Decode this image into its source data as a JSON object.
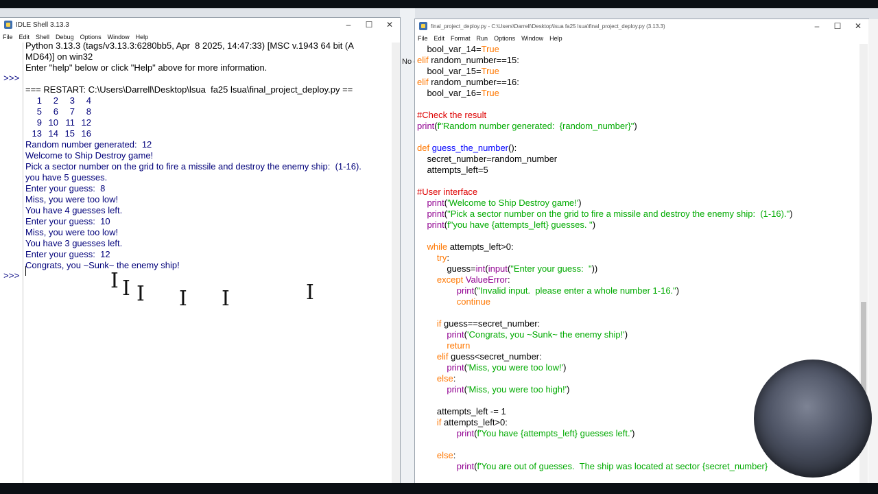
{
  "shell": {
    "title": "IDLE Shell 3.13.3",
    "menu": [
      "File",
      "Edit",
      "Shell",
      "Debug",
      "Options",
      "Window",
      "Help"
    ],
    "prompt": ">>>",
    "lines": [
      {
        "text": "Python 3.13.3 (tags/v3.13.3:6280bb5, Apr  8 2025, 14:47:33) [MSC v.1943 64 bit (A",
        "cls": "c-blk"
      },
      {
        "text": "MD64)] on win32",
        "cls": "c-blk"
      },
      {
        "text": "Enter \"help\" below or click \"Help\" above for more information.",
        "cls": "c-blk"
      },
      {
        "text": "",
        "cls": "c-blk"
      },
      {
        "text": "=== RESTART: C:\\Users\\Darrell\\Desktop\\lsua  fa25 lsua\\final_project_deploy.py ==",
        "cls": "c-blk"
      }
    ],
    "grid": [
      [
        "1",
        "2",
        "3",
        "4"
      ],
      [
        "5",
        "6",
        "7",
        "8"
      ],
      [
        "9",
        "10",
        "11",
        "12"
      ],
      [
        "13",
        "14",
        "15",
        "16"
      ]
    ],
    "output": [
      {
        "text": "Random number generated:  12",
        "cls": "c-out"
      },
      {
        "text": "Welcome to Ship Destroy game!",
        "cls": "c-out"
      },
      {
        "text": "Pick a sector number on the grid to fire a missile and destroy the enemy ship:  (1-16).",
        "cls": "c-out"
      },
      {
        "text": "you have 5 guesses.",
        "cls": "c-out"
      },
      {
        "text": "Enter your guess:  8",
        "cls": "c-out"
      },
      {
        "text": "Miss, you were too low!",
        "cls": "c-out"
      },
      {
        "text": "You have 4 guesses left.",
        "cls": "c-out"
      },
      {
        "text": "Enter your guess:  10",
        "cls": "c-out"
      },
      {
        "text": "Miss, you were too low!",
        "cls": "c-out"
      },
      {
        "text": "You have 3 guesses left.",
        "cls": "c-out"
      },
      {
        "text": "Enter your guess:  12",
        "cls": "c-out"
      },
      {
        "text": "Congrats, you ~Sunk~ the enemy ship!",
        "cls": "c-out"
      }
    ]
  },
  "editor": {
    "title": "final_project_deploy.py - C:\\Users\\Darrell\\Desktop\\lsua  fa25 lsua\\final_project_deploy.py (3.13.3)",
    "menu": [
      "File",
      "Edit",
      "Format",
      "Run",
      "Options",
      "Window",
      "Help"
    ],
    "code": [
      [
        {
          "t": "    bool_var_14="
        },
        {
          "t": "True",
          "c": "kw"
        }
      ],
      [
        {
          "t": "elif",
          "c": "kw"
        },
        {
          "t": " random_number==15:"
        }
      ],
      [
        {
          "t": "    bool_var_15="
        },
        {
          "t": "True",
          "c": "kw"
        }
      ],
      [
        {
          "t": "elif",
          "c": "kw"
        },
        {
          "t": " random_number==16:"
        }
      ],
      [
        {
          "t": "    bool_var_16="
        },
        {
          "t": "True",
          "c": "kw"
        }
      ],
      [
        {
          "t": ""
        }
      ],
      [
        {
          "t": "#Check the result",
          "c": "cm"
        }
      ],
      [
        {
          "t": "print",
          "c": "bi"
        },
        {
          "t": "("
        },
        {
          "t": "f\"Random number generated:  {random_number}\"",
          "c": "str"
        },
        {
          "t": ")"
        }
      ],
      [
        {
          "t": ""
        }
      ],
      [
        {
          "t": "def",
          "c": "kw"
        },
        {
          "t": " "
        },
        {
          "t": "guess_the_number",
          "c": "df"
        },
        {
          "t": "():"
        }
      ],
      [
        {
          "t": "    secret_number=random_number"
        }
      ],
      [
        {
          "t": "    attempts_left=5"
        }
      ],
      [
        {
          "t": ""
        }
      ],
      [
        {
          "t": "#User interface",
          "c": "cm"
        }
      ],
      [
        {
          "t": "    "
        },
        {
          "t": "print",
          "c": "bi"
        },
        {
          "t": "("
        },
        {
          "t": "'Welcome to Ship Destroy game!'",
          "c": "str"
        },
        {
          "t": ")"
        }
      ],
      [
        {
          "t": "    "
        },
        {
          "t": "print",
          "c": "bi"
        },
        {
          "t": "("
        },
        {
          "t": "\"Pick a sector number on the grid to fire a missile and destroy the enemy ship:  (1-16).\"",
          "c": "str"
        },
        {
          "t": ")"
        }
      ],
      [
        {
          "t": "    "
        },
        {
          "t": "print",
          "c": "bi"
        },
        {
          "t": "("
        },
        {
          "t": "f\"you have {attempts_left} guesses. \"",
          "c": "str"
        },
        {
          "t": ")"
        }
      ],
      [
        {
          "t": ""
        }
      ],
      [
        {
          "t": "    "
        },
        {
          "t": "while",
          "c": "kw"
        },
        {
          "t": " attempts_left>0:"
        }
      ],
      [
        {
          "t": "        "
        },
        {
          "t": "try",
          "c": "kw"
        },
        {
          "t": ":"
        }
      ],
      [
        {
          "t": "            guess="
        },
        {
          "t": "int",
          "c": "bi"
        },
        {
          "t": "("
        },
        {
          "t": "input",
          "c": "bi"
        },
        {
          "t": "("
        },
        {
          "t": "\"Enter your guess:  \"",
          "c": "str"
        },
        {
          "t": "))"
        }
      ],
      [
        {
          "t": "        "
        },
        {
          "t": "except",
          "c": "kw"
        },
        {
          "t": " "
        },
        {
          "t": "ValueError",
          "c": "bi"
        },
        {
          "t": ":"
        }
      ],
      [
        {
          "t": "                "
        },
        {
          "t": "print",
          "c": "bi"
        },
        {
          "t": "("
        },
        {
          "t": "\"Invalid input.  please enter a whole number 1-16.\"",
          "c": "str"
        },
        {
          "t": ")"
        }
      ],
      [
        {
          "t": "                "
        },
        {
          "t": "continue",
          "c": "kw"
        }
      ],
      [
        {
          "t": ""
        }
      ],
      [
        {
          "t": "        "
        },
        {
          "t": "if",
          "c": "kw"
        },
        {
          "t": " guess==secret_number:"
        }
      ],
      [
        {
          "t": "            "
        },
        {
          "t": "print",
          "c": "bi"
        },
        {
          "t": "("
        },
        {
          "t": "'Congrats, you ~Sunk~ the enemy ship!'",
          "c": "str"
        },
        {
          "t": ")"
        }
      ],
      [
        {
          "t": "            "
        },
        {
          "t": "return",
          "c": "kw"
        }
      ],
      [
        {
          "t": "        "
        },
        {
          "t": "elif",
          "c": "kw"
        },
        {
          "t": " guess<secret_number:"
        }
      ],
      [
        {
          "t": "            "
        },
        {
          "t": "print",
          "c": "bi"
        },
        {
          "t": "("
        },
        {
          "t": "'Miss, you were too low!'",
          "c": "str"
        },
        {
          "t": ")"
        }
      ],
      [
        {
          "t": "        "
        },
        {
          "t": "else",
          "c": "kw"
        },
        {
          "t": ":"
        }
      ],
      [
        {
          "t": "            "
        },
        {
          "t": "print",
          "c": "bi"
        },
        {
          "t": "("
        },
        {
          "t": "'Miss, you were too high!'",
          "c": "str"
        },
        {
          "t": ")"
        }
      ],
      [
        {
          "t": ""
        }
      ],
      [
        {
          "t": "        attempts_left -= 1"
        }
      ],
      [
        {
          "t": "        "
        },
        {
          "t": "if",
          "c": "kw"
        },
        {
          "t": " attempts_left>0:"
        }
      ],
      [
        {
          "t": "                "
        },
        {
          "t": "print",
          "c": "bi"
        },
        {
          "t": "("
        },
        {
          "t": "f'You have {attempts_left} guesses left.'",
          "c": "str"
        },
        {
          "t": ")"
        }
      ],
      [
        {
          "t": ""
        }
      ],
      [
        {
          "t": "        "
        },
        {
          "t": "else",
          "c": "kw"
        },
        {
          "t": ":"
        }
      ],
      [
        {
          "t": "                "
        },
        {
          "t": "print",
          "c": "bi"
        },
        {
          "t": "("
        },
        {
          "t": "f'You are out of guesses.  The ship was located at sector {secret_number}",
          "c": "str"
        }
      ]
    ]
  },
  "background": {
    "fragment": "No c"
  },
  "window_controls": {
    "minimize": "–",
    "maximize": "☐",
    "close": "✕"
  }
}
